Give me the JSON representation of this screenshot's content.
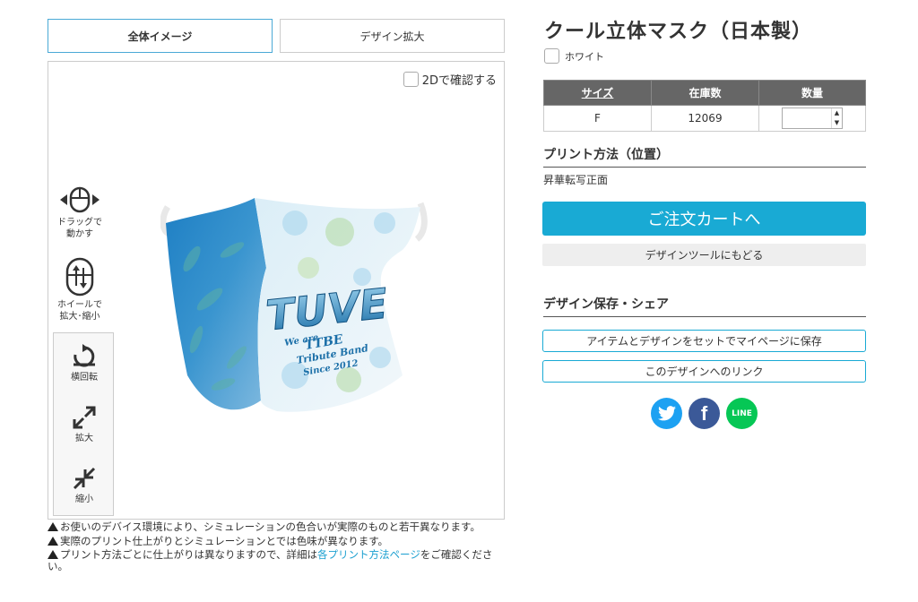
{
  "tabs": {
    "full": "全体イメージ",
    "zoom": "デザイン拡大"
  },
  "viewer": {
    "toggle_2d": "2Dで確認する",
    "controls": {
      "drag": [
        "ドラッグで",
        "動かす"
      ],
      "wheel": [
        "ホイールで",
        "拡大･縮小"
      ],
      "rotate": "横回転",
      "enlarge": "拡大",
      "shrink": "縮小"
    },
    "mask_print": {
      "main": "TUVE",
      "line1": "We are",
      "line2": "TTBE",
      "line3": "Tribute Band",
      "line4": "Since 2012"
    }
  },
  "notes": {
    "n1": "お使いのデバイス環境により、シミュレーションの色合いが実際のものと若干異なります。",
    "n2": "実際のプリント仕上がりとシミュレーションとでは色味が異なります。",
    "n3_pre": "プリント方法ごとに仕上がりは異なりますので、詳細は",
    "n3_link": "各プリント方法ページ",
    "n3_post": "をご確認ください。"
  },
  "product": {
    "title": "クール立体マスク（日本製）",
    "color": "ホワイト",
    "table": {
      "headers": {
        "size": "サイズ",
        "stock": "在庫数",
        "qty": "数量"
      },
      "rows": [
        {
          "size": "F",
          "stock": "12069",
          "qty": ""
        }
      ]
    },
    "print_heading": "プリント方法（位置）",
    "print_method": "昇華転写正面",
    "order_button": "ご注文カートへ",
    "back_button": "デザインツールにもどる",
    "save_heading": "デザイン保存・シェア",
    "save_button": "アイテムとデザインをセットでマイページに保存",
    "link_button": "このデザインへのリンク"
  },
  "social": {
    "line": "LINE",
    "facebook": "f"
  },
  "colors": {
    "accent": "#19aad4",
    "twitter": "#1da1f2",
    "facebook": "#3b5998",
    "line": "#06c755"
  }
}
